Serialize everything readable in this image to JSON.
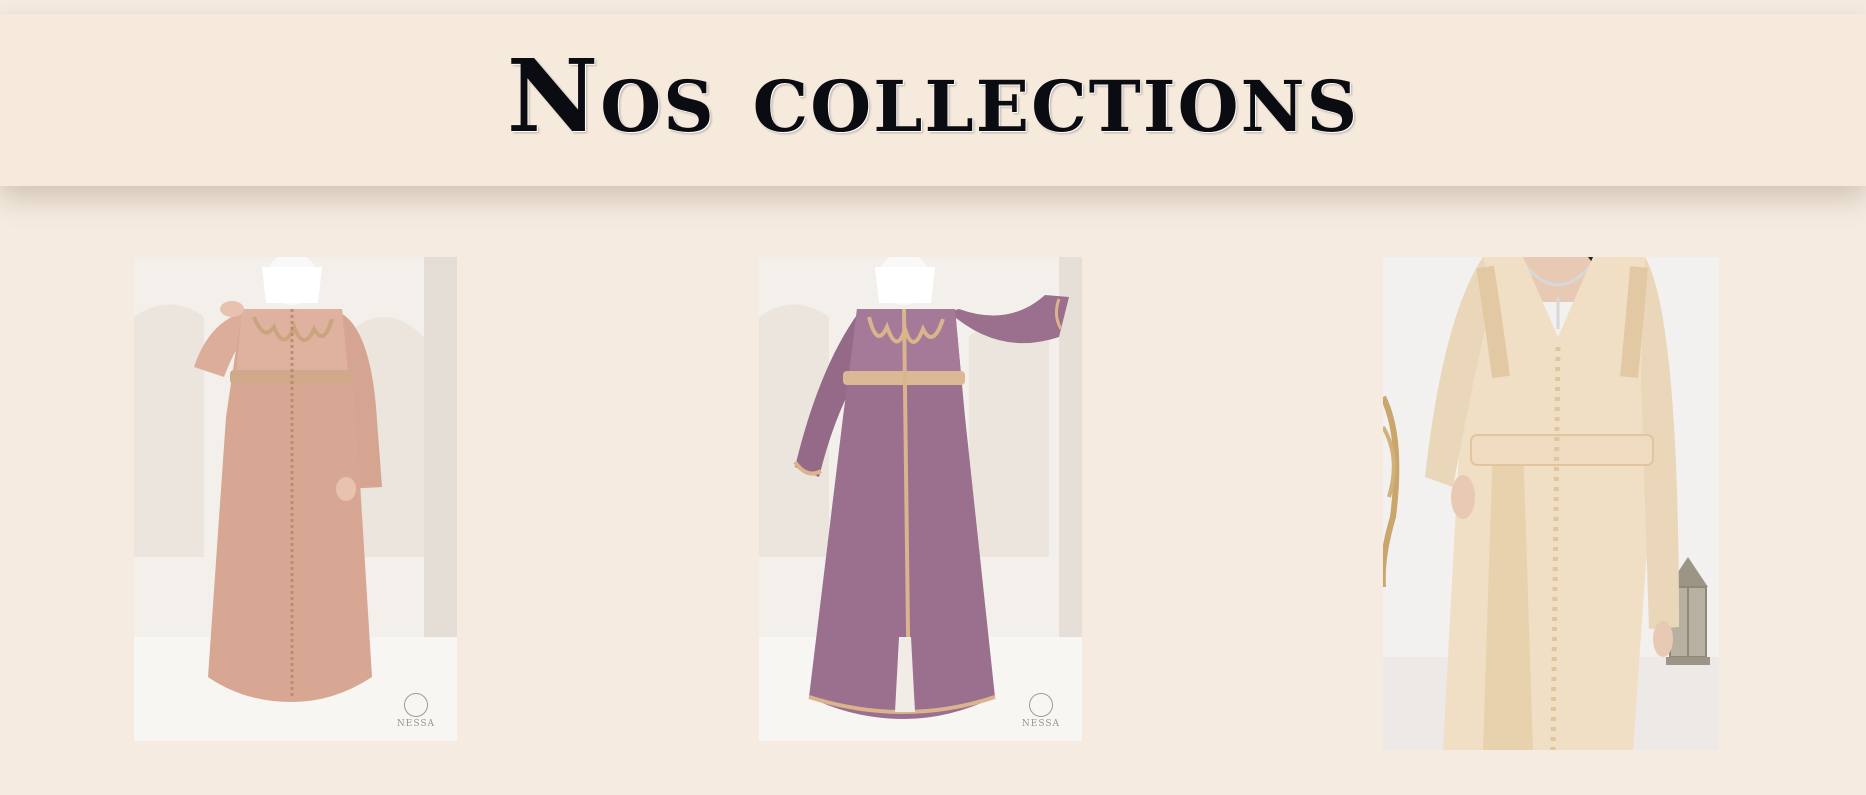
{
  "header": {
    "title": "Nos collections"
  },
  "collections": [
    {
      "name": "product-image-rose-caftan",
      "watermark": "NESSA",
      "dress_color": "#d8a793",
      "accent_color": "#c9a57e"
    },
    {
      "name": "product-image-mauve-caftan",
      "watermark": "NESSA",
      "dress_color": "#9b6f8e",
      "accent_color": "#d9b48c"
    },
    {
      "name": "product-image-ivory-caftan",
      "watermark": "",
      "dress_color": "#f0dfc4",
      "accent_color": "#e2c9a3"
    }
  ],
  "colors": {
    "background": "#f5ebe0",
    "header_background": "#f6eadd",
    "title": "#0b0b12"
  }
}
